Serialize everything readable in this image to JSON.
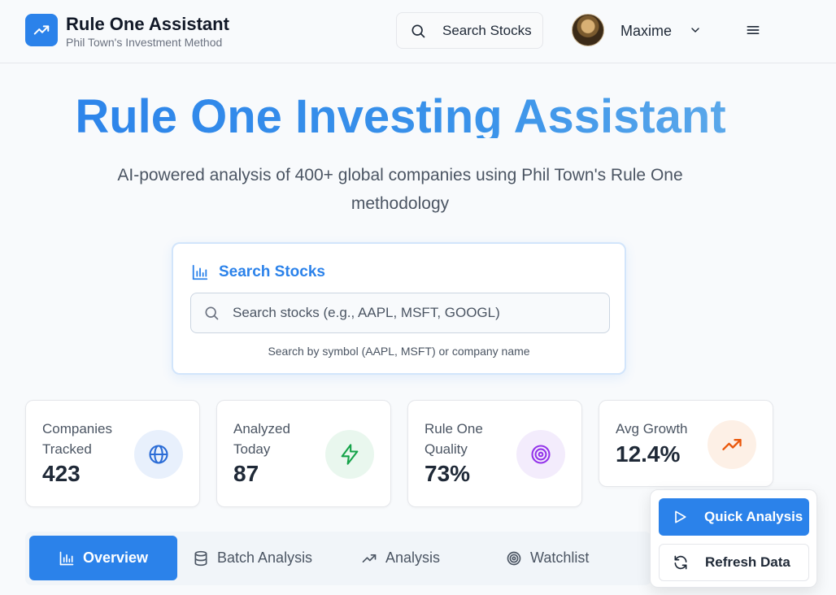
{
  "header": {
    "app_title": "Rule One Assistant",
    "app_subtitle": "Phil Town's Investment Method",
    "logo_icon": "trending-up-icon",
    "search_button_label": "Search Stocks",
    "user_name": "Maxime"
  },
  "hero": {
    "title": "Rule One Investing Assistant",
    "description": "AI-powered analysis of 400+ global companies using Phil Town's Rule One methodology"
  },
  "search_card": {
    "title": "Search Stocks",
    "placeholder": "Search stocks (e.g., AAPL, MSFT, GOOGL)",
    "value": "",
    "hint": "Search by symbol (AAPL, MSFT) or company name"
  },
  "stats": [
    {
      "label": "Companies Tracked",
      "value": "423",
      "icon": "globe-icon",
      "color": "#2b6cd6"
    },
    {
      "label": "Analyzed Today",
      "value": "87",
      "icon": "lightning-icon",
      "color": "#16a34a"
    },
    {
      "label": "Rule One Quality",
      "value": "73%",
      "icon": "target-icon",
      "color": "#9333ea"
    },
    {
      "label": "Avg Growth",
      "value": "12.4%",
      "icon": "trending-up-icon",
      "color": "#ea580c"
    }
  ],
  "tabs": [
    {
      "label": "Overview",
      "icon": "bar-chart-icon",
      "active": true
    },
    {
      "label": "Batch Analysis",
      "icon": "database-icon",
      "active": false
    },
    {
      "label": "Analysis",
      "icon": "trending-up-icon",
      "active": false
    },
    {
      "label": "Watchlist",
      "icon": "target-icon",
      "active": false
    }
  ],
  "actions": {
    "quick_analysis": "Quick Analysis",
    "refresh_data": "Refresh Data"
  },
  "colors": {
    "primary": "#2b82ea",
    "background": "#f8fafc"
  }
}
